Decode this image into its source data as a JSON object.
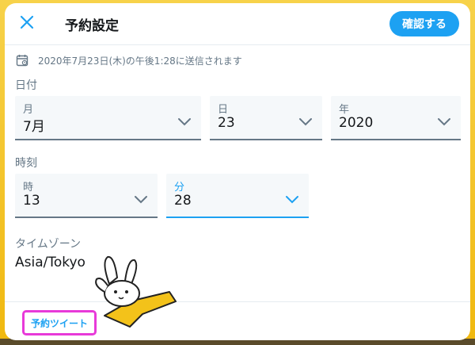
{
  "header": {
    "title": "予約設定",
    "confirm_label": "確認する"
  },
  "info": {
    "text": "2020年7月23日(木)の午後1:28に送信されます"
  },
  "date": {
    "section_label": "日付",
    "month": {
      "label": "月",
      "value": "7月"
    },
    "day": {
      "label": "日",
      "value": "23"
    },
    "year": {
      "label": "年",
      "value": "2020"
    }
  },
  "time": {
    "section_label": "時刻",
    "hour": {
      "label": "時",
      "value": "13"
    },
    "minute": {
      "label": "分",
      "value": "28"
    }
  },
  "timezone": {
    "label": "タイムゾーン",
    "value": "Asia/Tokyo"
  },
  "footer": {
    "scheduled_link": "予約ツイート"
  },
  "colors": {
    "accent": "#1da1f2",
    "highlight": "#e83ad9",
    "arrow": "#f3c21a",
    "backdrop": "#f3c21a"
  },
  "icons": [
    "close-icon",
    "calendar-icon",
    "chevron-down-icon",
    "arrow-icon",
    "rabbit-mascot"
  ]
}
